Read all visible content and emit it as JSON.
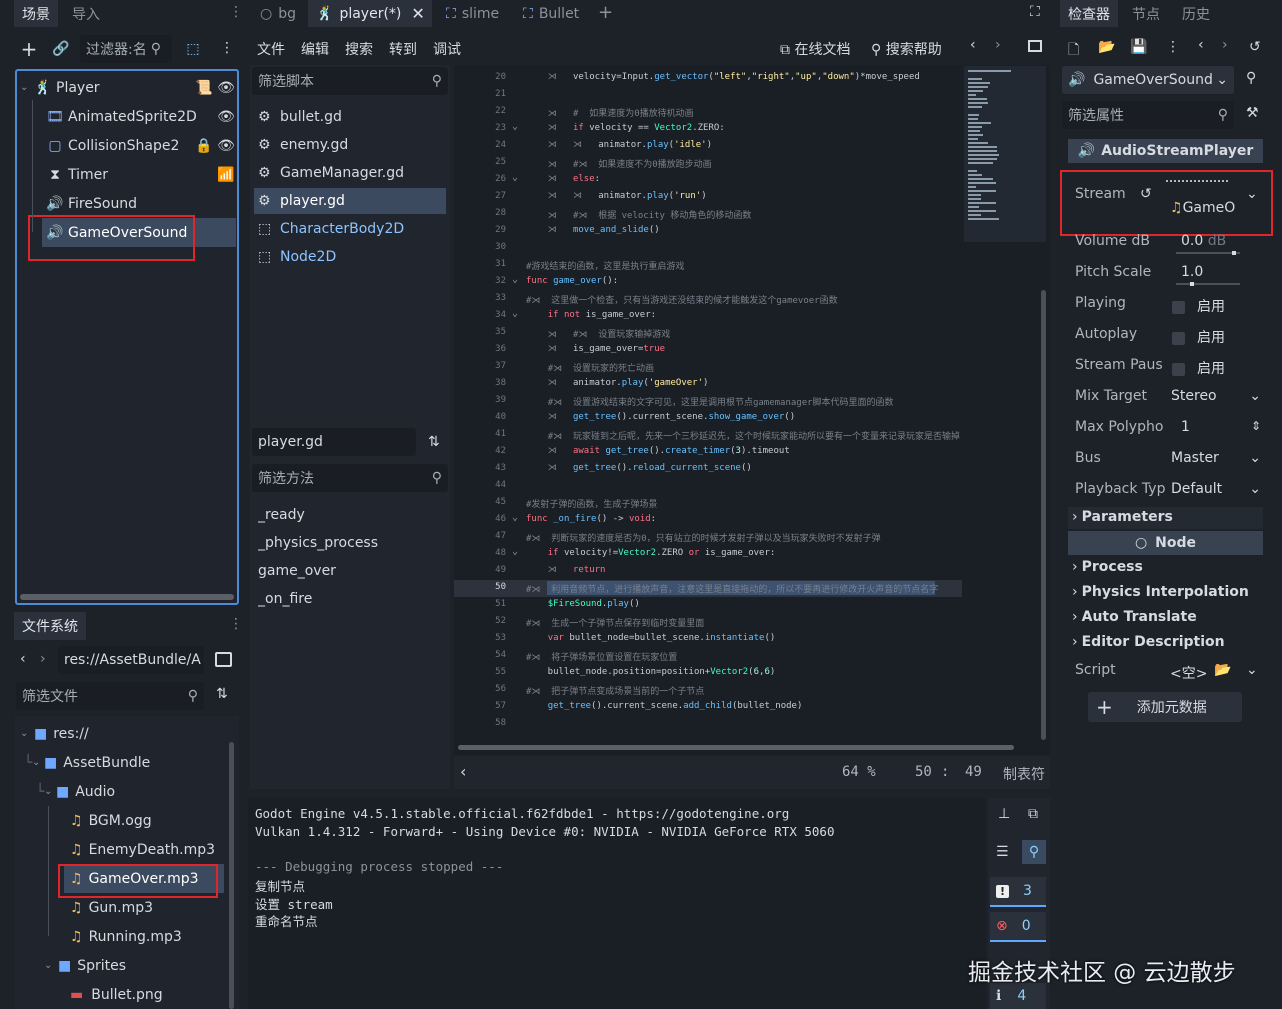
{
  "scene_dock": {
    "tabs": [
      "场景",
      "导入"
    ],
    "filter_placeholder": "过滤器:名",
    "tree": [
      {
        "name": "Player",
        "icon": "character-body-icon"
      },
      {
        "name": "AnimatedSprite2D",
        "icon": "animated-sprite-icon"
      },
      {
        "name": "CollisionShape2",
        "icon": "collision-shape-icon"
      },
      {
        "name": "Timer",
        "icon": "timer-icon"
      },
      {
        "name": "FireSound",
        "icon": "audio-stream-player-icon"
      },
      {
        "name": "GameOverSound",
        "icon": "audio-stream-player-icon"
      }
    ]
  },
  "filesystem": {
    "tab": "文件系统",
    "path": "res://AssetBundle/A",
    "filter_placeholder": "筛选文件",
    "tree": [
      {
        "name": "res://",
        "type": "folder"
      },
      {
        "name": "AssetBundle",
        "type": "folder"
      },
      {
        "name": "Audio",
        "type": "folder"
      },
      {
        "name": "BGM.ogg",
        "type": "audio"
      },
      {
        "name": "EnemyDeath.mp3",
        "type": "audio"
      },
      {
        "name": "GameOver.mp3",
        "type": "audio"
      },
      {
        "name": "Gun.mp3",
        "type": "audio"
      },
      {
        "name": "Running.mp3",
        "type": "audio"
      },
      {
        "name": "Sprites",
        "type": "folder"
      },
      {
        "name": "Bullet.png",
        "type": "image"
      }
    ]
  },
  "editor_tabs": [
    "bg",
    "player(*)",
    "slime",
    "Bullet"
  ],
  "menu": [
    "文件",
    "编辑",
    "搜索",
    "转到",
    "调试"
  ],
  "toolbar": {
    "online_docs": "在线文档",
    "search_help": "搜索帮助"
  },
  "script_list": {
    "filter_placeholder": "筛选脚本",
    "items": [
      "bullet.gd",
      "enemy.gd",
      "GameManager.gd",
      "player.gd",
      "CharacterBody2D",
      "Node2D"
    ],
    "current": "player.gd",
    "methods_filter_placeholder": "筛选方法",
    "methods": [
      "_ready",
      "_physics_process",
      "game_over",
      "_on_fire"
    ]
  },
  "code_lines": [
    {
      "n": "20",
      "html": "    <span class='cm'>⋊</span>   velocity=Input.<span class='fn'>get_vector</span>(<span class='st'>\"left\"</span>,<span class='st'>\"right\"</span>,<span class='st'>\"up\"</span>,<span class='st'>\"down\"</span>)*move_speed"
    },
    {
      "n": "21",
      "html": ""
    },
    {
      "n": "22",
      "html": "    <span class='cm'>⋊   #  如果速度为0播放待机动画</span>"
    },
    {
      "n": "23",
      "html": "    <span class='cm'>⋊</span>   <span class='kw'>if</span> velocity == <span class='ty'>Vector2</span>.ZERO:"
    },
    {
      "n": "24",
      "html": "    <span class='cm'>⋊   ⋊</span>   animator.<span class='fn'>play</span>(<span class='st'>'idle'</span>)"
    },
    {
      "n": "25",
      "html": "    <span class='cm'>⋊   #⋊  如果速度不为0播放跑步动画</span>"
    },
    {
      "n": "26",
      "html": "    <span class='cm'>⋊</span>   <span class='kw'>else</span>:"
    },
    {
      "n": "27",
      "html": "    <span class='cm'>⋊   ⋊</span>   animator.<span class='fn'>play</span>(<span class='st'>'run'</span>)"
    },
    {
      "n": "28",
      "html": "    <span class='cm'>⋊   #⋊  根据 velocity 移动角色的移动函数</span>"
    },
    {
      "n": "29",
      "html": "    <span class='cm'>⋊</span>   <span class='fn'>move_and_slide</span>()"
    },
    {
      "n": "30",
      "html": ""
    },
    {
      "n": "31",
      "html": "<span class='cm'>#游戏结束的函数，这里是执行重启游戏</span>"
    },
    {
      "n": "32",
      "html": "<span class='kw'>func</span> <span class='fn'>game_over</span>():"
    },
    {
      "n": "33",
      "html": "<span class='cm'>#⋊  这里做一个检查，只有当游戏还没结束的候才能触发这个gamevoer函数</span>"
    },
    {
      "n": "34",
      "html": "    <span class='kw'>if not</span> is_game_over:"
    },
    {
      "n": "35",
      "html": "    <span class='cm'>⋊   #⋊  设置玩家输掉游戏</span>"
    },
    {
      "n": "36",
      "html": "    <span class='cm'>⋊</span>   is_game_over=<span class='kw'>true</span>"
    },
    {
      "n": "37",
      "html": "    <span class='cm'>#⋊  设置玩家的死亡动画</span>"
    },
    {
      "n": "38",
      "html": "    <span class='cm'>⋊</span>   animator.<span class='fn'>play</span>(<span class='st'>'gameOver'</span>)"
    },
    {
      "n": "39",
      "html": "    <span class='cm'>#⋊  设置游戏结束的文字可见，这里是调用根节点gamemanager脚本代码里面的函数</span>"
    },
    {
      "n": "40",
      "html": "    <span class='cm'>⋊</span>   <span class='fn'>get_tree</span>().current_scene.<span class='fn'>show_game_over</span>()"
    },
    {
      "n": "41",
      "html": "    <span class='cm'>#⋊  玩家碰到之后呢，先来一个三秒延迟先，这个时候玩家能动所以要有一个变量来记录玩家是否输掉</span>"
    },
    {
      "n": "42",
      "html": "    <span class='cm'>⋊</span>   <span class='kw'>await</span> <span class='fn'>get_tree</span>().<span class='fn'>create_timer</span>(<span class='nm'>3</span>).timeout"
    },
    {
      "n": "43",
      "html": "    <span class='cm'>⋊</span>   <span class='fn'>get_tree</span>().<span class='fn'>reload_current_scene</span>()"
    },
    {
      "n": "44",
      "html": ""
    },
    {
      "n": "45",
      "html": "<span class='cm'>#发射子弹的函数，生成子弹场景</span>"
    },
    {
      "n": "46",
      "html": "<span class='kw'>func</span> <span class='fn'>_on_fire</span>() -> <span class='kw'>void</span>:"
    },
    {
      "n": "47",
      "html": "<span class='cm'>#⋊  判断玩家的速度是否为0，只有站立的时候才发射子弹以及当玩家失败时不发射子弹</span>"
    },
    {
      "n": "48",
      "html": "    <span class='kw'>if</span> velocity!=<span class='ty'>Vector2</span>.ZERO <span class='kw'>or</span> is_game_over:"
    },
    {
      "n": "49",
      "html": "    <span class='cm'>⋊</span>   <span class='kw'>return</span>"
    },
    {
      "n": "50",
      "html": "<span class='cm'>#⋊  利用音频节点，进行播放声音，注意这里是直接拖动的，所以不要再进行修改开火声音的节点名字</span>"
    },
    {
      "n": "51",
      "html": "    <span class='ty'>$FireSound</span>.<span class='fn'>play</span>()"
    },
    {
      "n": "52",
      "html": "<span class='cm'>#⋊  生成一个子弹节点保存到临时变量里面</span>"
    },
    {
      "n": "53",
      "html": "    <span class='kw'>var</span> bullet_node=bullet_scene.<span class='fn'>instantiate</span>()"
    },
    {
      "n": "54",
      "html": "<span class='cm'>#⋊  将子弹场景位置设置在玩家位置</span>"
    },
    {
      "n": "55",
      "html": "    bullet_node.position=position+<span class='ty'>Vector2</span>(<span class='nm'>6</span>,<span class='nm'>6</span>)"
    },
    {
      "n": "56",
      "html": "<span class='cm'>#⋊  把子弹节点变成场景当前的一个子节点</span>"
    },
    {
      "n": "57",
      "html": "    <span class='fn'>get_tree</span>().current_scene.<span class='fn'>add_child</span>(bullet_node)"
    },
    {
      "n": "58",
      "html": ""
    }
  ],
  "status": {
    "zoom": "64 %",
    "line": "50",
    "sep": ":",
    "col": "49",
    "indent": "制表符"
  },
  "output_lines": [
    "Godot Engine v4.5.1.stable.official.f62fdbde1 - https://godotengine.org",
    "Vulkan 1.4.312 - Forward+ - Using Device #0: NVIDIA - NVIDIA GeForce RTX 5060",
    "",
    "--- Debugging process stopped ---",
    "复制节点",
    "设置 stream",
    "重命名节点"
  ],
  "output_counts": {
    "errors": "3",
    "warnings": "0",
    "info": "4"
  },
  "inspector": {
    "tabs": [
      "检查器",
      "节点",
      "历史"
    ],
    "node_name": "GameOverSound",
    "filter_placeholder": "筛选属性",
    "class_name": "AudioStreamPlayer",
    "stream_label": "Stream",
    "stream_value": "GameO",
    "props": [
      {
        "label": "Volume dB",
        "value": "0.0",
        "unit": "dB"
      },
      {
        "label": "Pitch Scale",
        "value": "1.0"
      },
      {
        "label": "Playing",
        "value": "启用"
      },
      {
        "label": "Autoplay",
        "value": "启用"
      },
      {
        "label": "Stream Paus",
        "value": "启用"
      },
      {
        "label": "Mix Target",
        "value": "Stereo"
      },
      {
        "label": "Max Polypho",
        "value": "1"
      },
      {
        "label": "Bus",
        "value": "Master"
      },
      {
        "label": "Playback Typ",
        "value": "Default"
      }
    ],
    "sections": [
      "Parameters",
      "Node",
      "Process",
      "Physics Interpolation",
      "Auto Translate",
      "Editor Description"
    ],
    "script_label": "Script",
    "script_value": "<空>",
    "add_metadata": "添加元数据"
  },
  "watermark": "掘金技术社区 @ 云边散步"
}
